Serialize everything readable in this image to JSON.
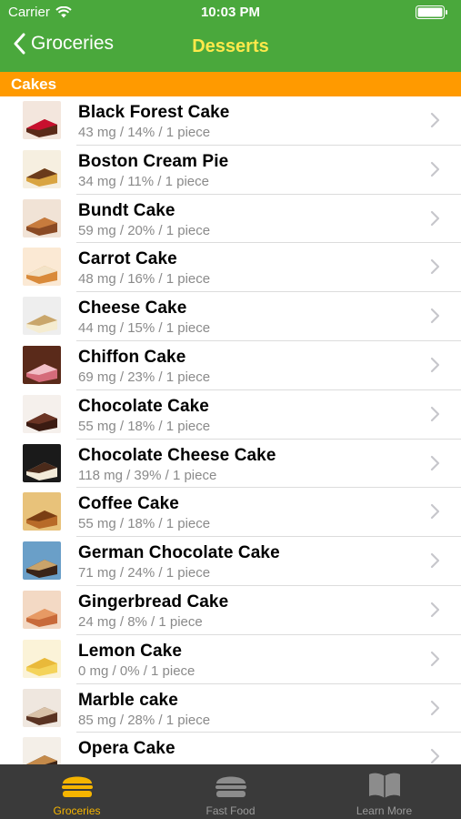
{
  "status_bar": {
    "carrier": "Carrier",
    "time": "10:03 PM"
  },
  "nav": {
    "back_label": "Groceries",
    "title": "Desserts"
  },
  "section": {
    "title": "Cakes"
  },
  "items": [
    {
      "name": "Black Forest Cake",
      "detail": "43 mg / 14% / 1 piece",
      "thumb": [
        "#f3e6dd",
        "#5a2a18",
        "#c8102e"
      ]
    },
    {
      "name": "Boston Cream Pie",
      "detail": "34 mg / 11% / 1 piece",
      "thumb": [
        "#f6efe0",
        "#d9a441",
        "#6b3b1b"
      ]
    },
    {
      "name": "Bundt Cake",
      "detail": "59 mg / 20% / 1 piece",
      "thumb": [
        "#f1e3d6",
        "#8a4a24",
        "#c77b3d"
      ]
    },
    {
      "name": "Carrot Cake",
      "detail": "48 mg / 16% / 1 piece",
      "thumb": [
        "#fbe9d4",
        "#d98a3a",
        "#f3e3c8"
      ]
    },
    {
      "name": "Cheese Cake",
      "detail": "44 mg / 15% / 1 piece",
      "thumb": [
        "#eeeeee",
        "#f5ecd0",
        "#c9a66b"
      ]
    },
    {
      "name": "Chiffon Cake",
      "detail": "69 mg / 23% / 1 piece",
      "thumb": [
        "#5a2a1a",
        "#d56b7a",
        "#f2c0c8"
      ]
    },
    {
      "name": "Chocolate Cake",
      "detail": "55 mg / 18% / 1 piece",
      "thumb": [
        "#f5f0ec",
        "#3b1b12",
        "#6b3424"
      ]
    },
    {
      "name": "Chocolate Cheese Cake",
      "detail": "118 mg / 39% / 1 piece",
      "thumb": [
        "#1a1a1a",
        "#f2ead8",
        "#4a2a1a"
      ]
    },
    {
      "name": "Coffee Cake",
      "detail": "55 mg / 18% / 1 piece",
      "thumb": [
        "#e8c27a",
        "#b86a28",
        "#7a3e14"
      ]
    },
    {
      "name": "German Chocolate Cake",
      "detail": "71 mg / 24% / 1 piece",
      "thumb": [
        "#6a9fc8",
        "#3a2418",
        "#c9a36a"
      ]
    },
    {
      "name": "Gingerbread Cake",
      "detail": "24 mg / 8% / 1 piece",
      "thumb": [
        "#f3d9c4",
        "#c86a3a",
        "#e79a64"
      ]
    },
    {
      "name": "Lemon Cake",
      "detail": "0 mg / 0% / 1 piece",
      "thumb": [
        "#fbf3d8",
        "#f4d35a",
        "#e9b93a"
      ]
    },
    {
      "name": "Marble cake",
      "detail": "85 mg / 28% / 1 piece",
      "thumb": [
        "#efe7df",
        "#5a3322",
        "#d9c2a8"
      ]
    },
    {
      "name": "Opera Cake",
      "detail": "",
      "thumb": [
        "#f4efe8",
        "#3a2418",
        "#c48a4a"
      ]
    }
  ],
  "tabs": [
    {
      "label": "Groceries",
      "icon": "burger-icon",
      "active": true
    },
    {
      "label": "Fast Food",
      "icon": "burger-icon",
      "active": false
    },
    {
      "label": "Learn More",
      "icon": "book-icon",
      "active": false
    }
  ],
  "colors": {
    "nav_bg": "#4aa83c",
    "nav_title": "#ffe94a",
    "section_bg": "#ff9a00",
    "tab_active": "#f5b400",
    "tab_inactive": "#9a9a9a",
    "tabbar_bg": "#3a3a3a"
  }
}
